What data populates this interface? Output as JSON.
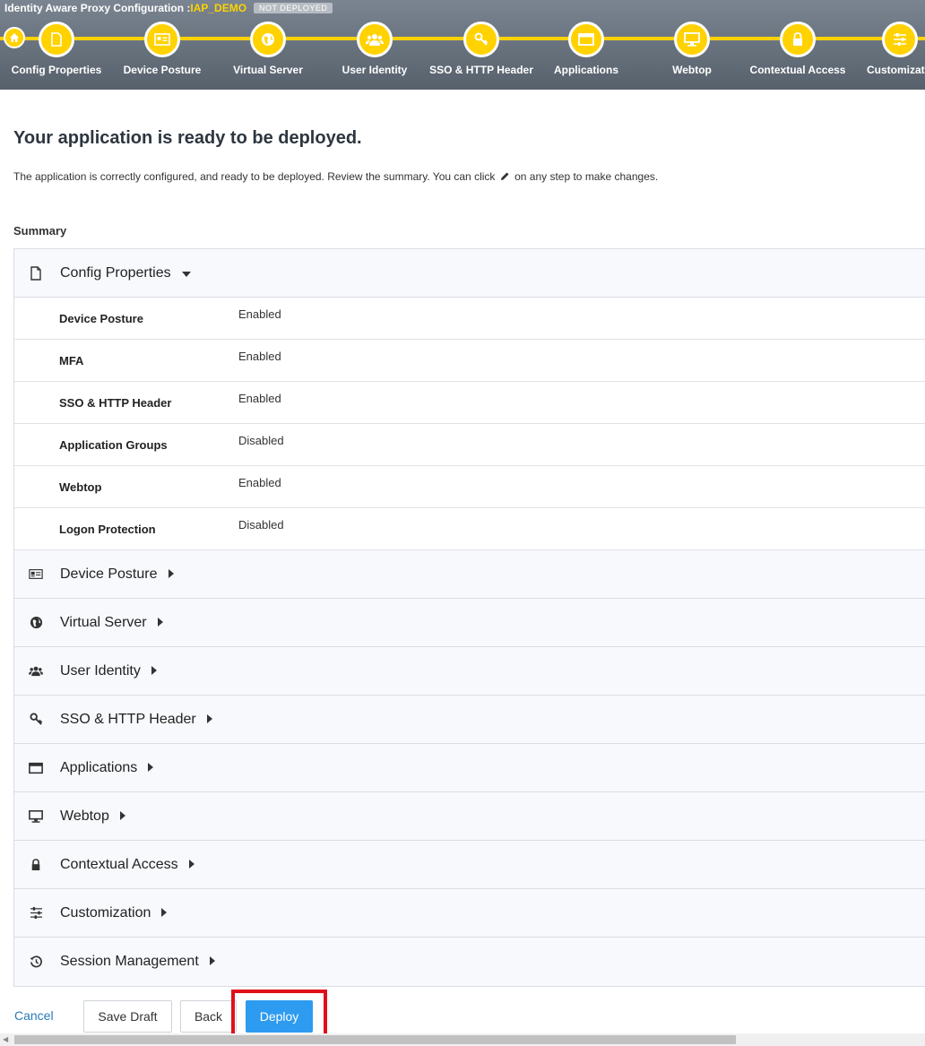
{
  "header": {
    "title_prefix": "Identity Aware Proxy Configuration : ",
    "title_name": "IAP_DEMO",
    "status_badge": "NOT DEPLOYED",
    "steps": [
      {
        "label": "Config Properties",
        "icon": "file-icon"
      },
      {
        "label": "Device Posture",
        "icon": "id-card-icon"
      },
      {
        "label": "Virtual Server",
        "icon": "globe-icon"
      },
      {
        "label": "User Identity",
        "icon": "users-icon"
      },
      {
        "label": "SSO & HTTP Header",
        "icon": "key-icon"
      },
      {
        "label": "Applications",
        "icon": "window-icon"
      },
      {
        "label": "Webtop",
        "icon": "monitor-icon"
      },
      {
        "label": "Contextual Access",
        "icon": "lock-icon"
      },
      {
        "label": "Customizati",
        "icon": "sliders-icon"
      }
    ]
  },
  "main": {
    "heading": "Your application is ready to be deployed.",
    "description_before": "The application is correctly configured, and ready to be deployed. Review the summary. You can click",
    "description_after": "on any step to make changes.",
    "summary_label": "Summary"
  },
  "summary": {
    "config_properties": {
      "title": "Config Properties",
      "rows": [
        {
          "label": "Device Posture",
          "value": "Enabled"
        },
        {
          "label": "MFA",
          "value": "Enabled"
        },
        {
          "label": "SSO & HTTP Header",
          "value": "Enabled"
        },
        {
          "label": "Application Groups",
          "value": "Disabled"
        },
        {
          "label": "Webtop",
          "value": "Enabled"
        },
        {
          "label": "Logon Protection",
          "value": "Disabled"
        }
      ]
    },
    "sections": [
      {
        "title": "Device Posture",
        "icon": "id-card-icon"
      },
      {
        "title": "Virtual Server",
        "icon": "globe-icon"
      },
      {
        "title": "User Identity",
        "icon": "users-icon"
      },
      {
        "title": "SSO & HTTP Header",
        "icon": "key-icon"
      },
      {
        "title": "Applications",
        "icon": "window-icon"
      },
      {
        "title": "Webtop",
        "icon": "monitor-icon"
      },
      {
        "title": "Contextual Access",
        "icon": "lock-icon"
      },
      {
        "title": "Customization",
        "icon": "sliders-icon"
      },
      {
        "title": "Session Management",
        "icon": "history-icon"
      }
    ]
  },
  "footer": {
    "cancel": "Cancel",
    "save_draft": "Save Draft",
    "back": "Back",
    "deploy": "Deploy"
  },
  "colors": {
    "accent_yellow": "#ffd200",
    "deploy_blue": "#2d9bf0",
    "highlight_red": "#e0101a",
    "header_gray": "#6a747f"
  }
}
